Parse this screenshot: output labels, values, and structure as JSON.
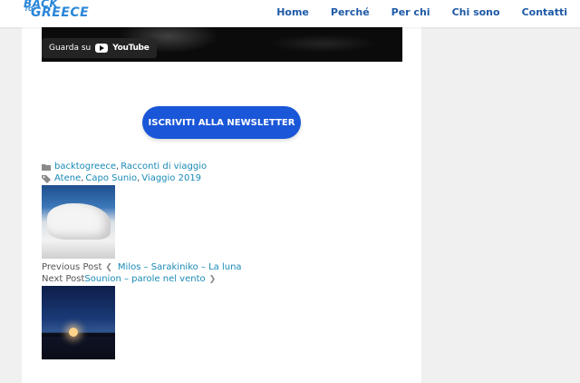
{
  "header": {
    "logo": {
      "line1": "BACK",
      "line2": "TO",
      "line3": "GREECE"
    },
    "nav": [
      "Home",
      "Perché",
      "Per chi",
      "Chi sono",
      "Contatti"
    ]
  },
  "video": {
    "watch_on": "Guarda su",
    "brand": "YouTube"
  },
  "newsletter_button": "ISCRIVITI ALLA NEWSLETTER",
  "meta": {
    "categories": [
      "backtogreece",
      "Racconti di viaggio"
    ],
    "tags": [
      "Atene",
      "Capo Sunio",
      "Viaggio 2019"
    ]
  },
  "post_nav": {
    "previous_label": "Previous Post",
    "previous_title": "Milos – Sarakiniko – La luna",
    "next_label": "Next Post",
    "next_title": "Sounion – parole nel vento"
  },
  "colors": {
    "nav": "#1f5aa6",
    "link": "#1a8ab8",
    "button": "#1a56d8",
    "logo": "#2a86d8"
  }
}
